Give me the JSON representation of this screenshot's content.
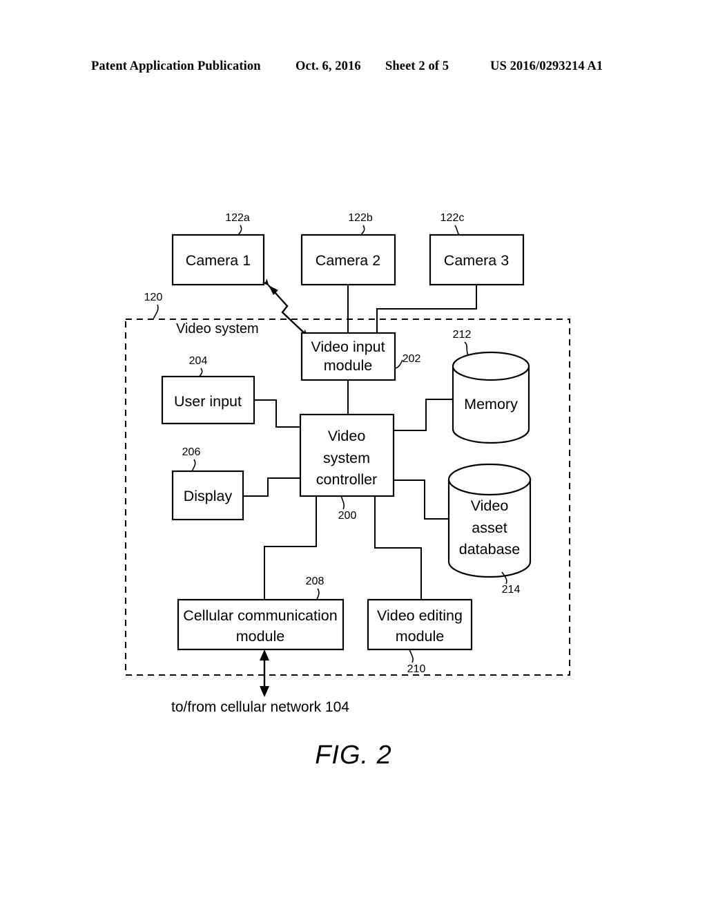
{
  "header": {
    "publication": "Patent Application Publication",
    "date": "Oct. 6, 2016",
    "sheet": "Sheet 2 of 5",
    "patent_number": "US 2016/0293214 A1"
  },
  "figure": {
    "caption": "FIG. 2",
    "system_label": "Video system",
    "system_ref": "120",
    "network_label": "to/from cellular network 104"
  },
  "cameras": [
    {
      "label": "Camera 1",
      "ref": "122a"
    },
    {
      "label": "Camera 2",
      "ref": "122b"
    },
    {
      "label": "Camera 3",
      "ref": "122c"
    }
  ],
  "blocks": {
    "video_input_module": {
      "line1": "Video input",
      "line2": "module",
      "ref": "202"
    },
    "user_input": {
      "line1": "User input",
      "ref": "204"
    },
    "display": {
      "line1": "Display",
      "ref": "206"
    },
    "controller": {
      "line1": "Video",
      "line2": "system",
      "line3": "controller",
      "ref": "200"
    },
    "memory": {
      "line1": "Memory",
      "ref": "212"
    },
    "video_asset_database": {
      "line1": "Video",
      "line2": "asset",
      "line3": "database",
      "ref": "214"
    },
    "cellular_communication_module": {
      "line1": "Cellular communication",
      "line2": "module",
      "ref": "208"
    },
    "video_editing_module": {
      "line1": "Video editing",
      "line2": "module",
      "ref": "210"
    }
  },
  "colors": {
    "ink": "#000000",
    "paper": "#ffffff"
  }
}
